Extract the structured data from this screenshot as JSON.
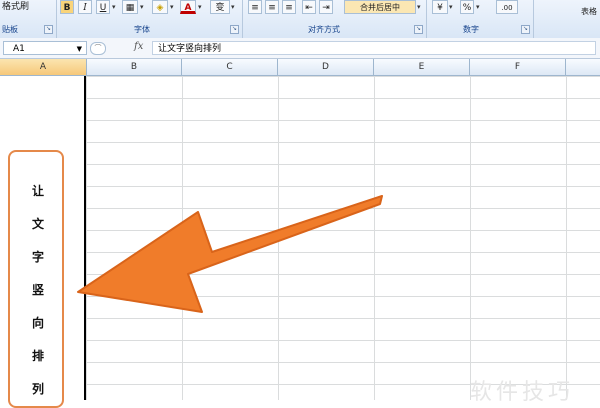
{
  "ribbon": {
    "format_painter": "格式刷",
    "clipboard_label": "贴板",
    "bold": "B",
    "italic": "I",
    "underline": "U",
    "font_color": "A",
    "phonetic": "变",
    "font_label": "字体",
    "merge_center": "合并后居中",
    "alignment_label": "对齐方式",
    "percent": "%",
    "decimals": ".00",
    "number_label": "数字",
    "table_format": "表格"
  },
  "formula_bar": {
    "name_box": "A1",
    "fx": "fx",
    "content": "让文字竖向排列"
  },
  "columns": [
    "A",
    "B",
    "C",
    "D",
    "E",
    "F"
  ],
  "cell_a1_chars": [
    "让",
    "文",
    "字",
    "竖",
    "向",
    "排",
    "列"
  ],
  "watermark": "软件技巧",
  "colors": {
    "arrow": "#f07c2a",
    "callout_border": "#e5894a",
    "selected_header": "#f6c87a"
  }
}
